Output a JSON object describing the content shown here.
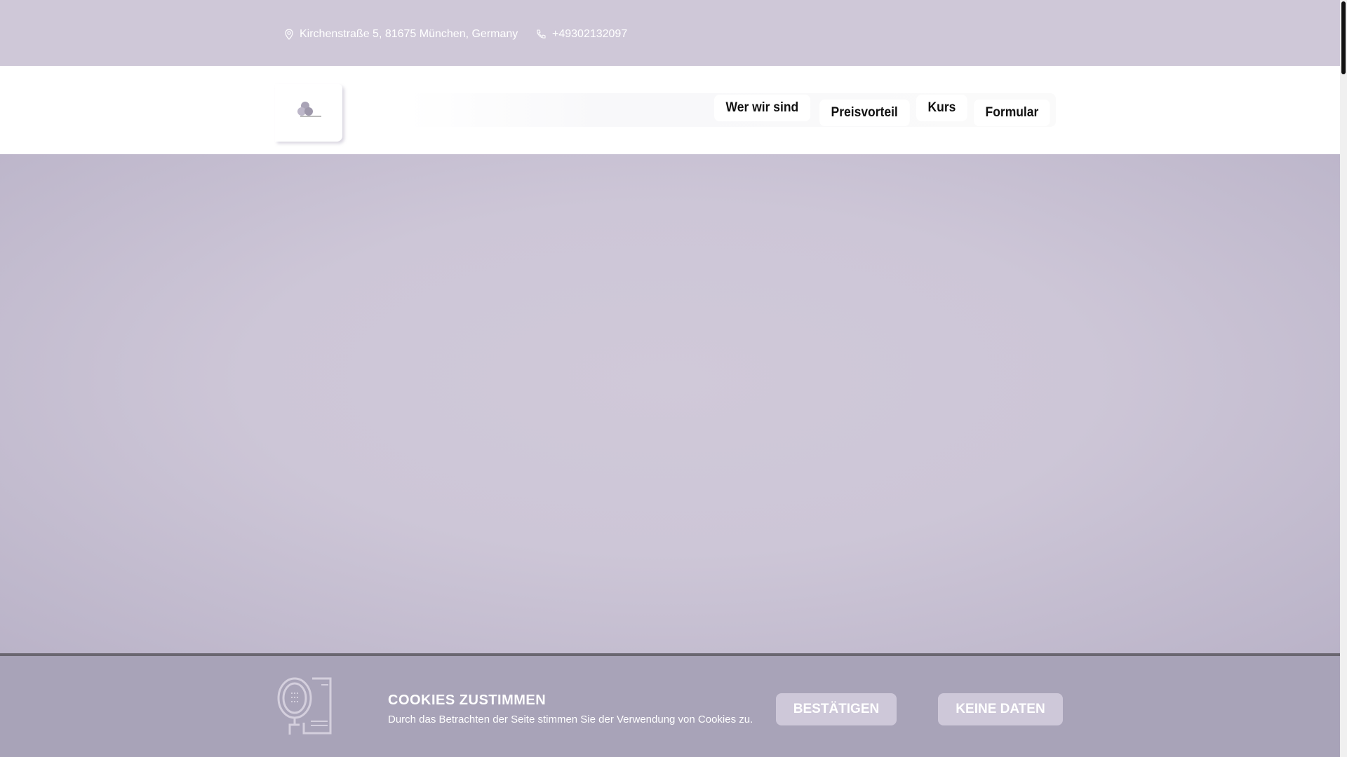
{
  "topbar": {
    "address": "Kirchenstraße 5, 81675 München, Germany",
    "phone": "+49302132097"
  },
  "nav": {
    "items": [
      {
        "label": "Wer wir sind"
      },
      {
        "label": "Preisvorteil"
      },
      {
        "label": "Kurs"
      },
      {
        "label": "Formular"
      }
    ]
  },
  "cookie": {
    "title": "COOKIES ZUSTIMMEN",
    "text": "Durch das Betrachten der Seite stimmen Sie der Verwendung von Cookies zu.",
    "accept": "BESTÄTIGEN",
    "decline": "KEINE DATEN"
  },
  "colors": {
    "topbar": "#cfc8d8",
    "cookie_bg": "#a8a3b8",
    "button": "#cec8d9"
  }
}
